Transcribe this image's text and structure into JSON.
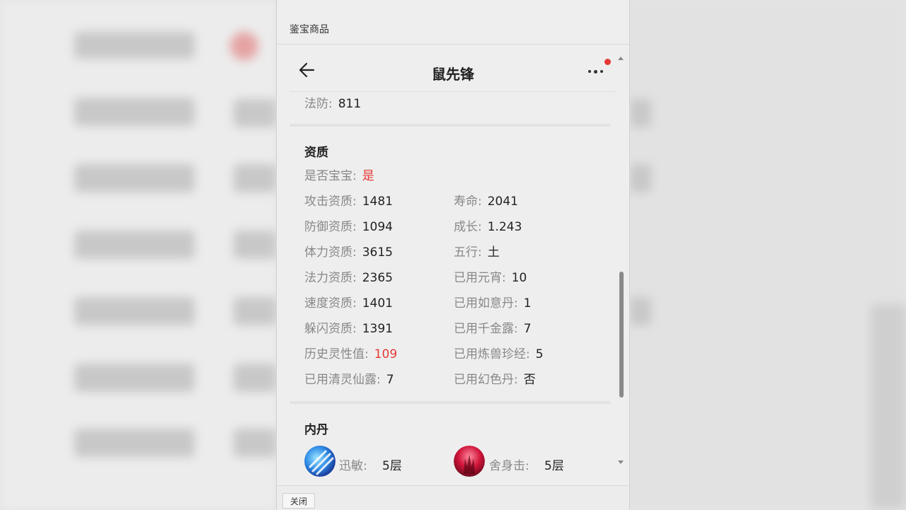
{
  "modal": {
    "title": "鉴宝商品",
    "close_label": "关闭"
  },
  "nav": {
    "title": "鼠先锋"
  },
  "top_line": {
    "label": "法防:",
    "value": "811"
  },
  "aptitude": {
    "section_title": "资质",
    "is_baby": {
      "label": "是否宝宝:",
      "value": "是"
    },
    "left": [
      {
        "label": "攻击资质:",
        "value": "1481"
      },
      {
        "label": "防御资质:",
        "value": "1094"
      },
      {
        "label": "体力资质:",
        "value": "3615"
      },
      {
        "label": "法力资质:",
        "value": "2365"
      },
      {
        "label": "速度资质:",
        "value": "1401"
      },
      {
        "label": "躲闪资质:",
        "value": "1391"
      },
      {
        "label": "历史灵性值:",
        "value": "109"
      },
      {
        "label": "已用清灵仙露:",
        "value": "7"
      }
    ],
    "right": [
      {
        "label": "寿命:",
        "value": "2041"
      },
      {
        "label": "成长:",
        "value": "1.243"
      },
      {
        "label": "五行:",
        "value": "土"
      },
      {
        "label": "已用元宵:",
        "value": "10"
      },
      {
        "label": "已用如意丹:",
        "value": "1"
      },
      {
        "label": "已用千金露:",
        "value": "7"
      },
      {
        "label": "已用炼兽珍经:",
        "value": "5"
      },
      {
        "label": "已用幻色丹:",
        "value": "否"
      }
    ]
  },
  "neidan": {
    "section_title": "内丹",
    "items": [
      {
        "name": "迅敏:",
        "layers": "5层",
        "icon": "blue-swirl-icon"
      },
      {
        "name": "舍身击:",
        "layers": "5层",
        "icon": "red-flame-icon"
      }
    ]
  },
  "colors": {
    "accent_red": "#e53935"
  }
}
